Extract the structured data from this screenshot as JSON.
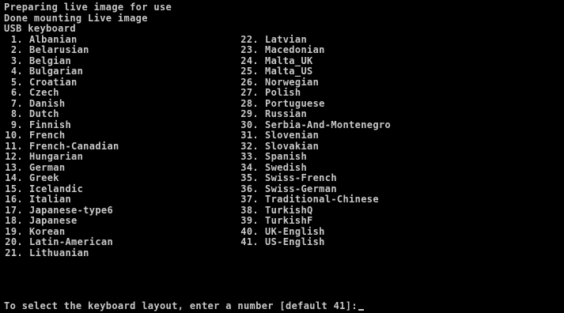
{
  "colors": {
    "background": "#000000",
    "text": "#c8c8c8"
  },
  "console": {
    "status_lines": [
      "Preparing live image for use",
      "Done mounting Live image",
      "USB keyboard"
    ],
    "keyboard_layouts": {
      "left": [
        {
          "num": "1.",
          "label": "Albanian"
        },
        {
          "num": "2.",
          "label": "Belarusian"
        },
        {
          "num": "3.",
          "label": "Belgian"
        },
        {
          "num": "4.",
          "label": "Bulgarian"
        },
        {
          "num": "5.",
          "label": "Croatian"
        },
        {
          "num": "6.",
          "label": "Czech"
        },
        {
          "num": "7.",
          "label": "Danish"
        },
        {
          "num": "8.",
          "label": "Dutch"
        },
        {
          "num": "9.",
          "label": "Finnish"
        },
        {
          "num": "10.",
          "label": "French"
        },
        {
          "num": "11.",
          "label": "French-Canadian"
        },
        {
          "num": "12.",
          "label": "Hungarian"
        },
        {
          "num": "13.",
          "label": "German"
        },
        {
          "num": "14.",
          "label": "Greek"
        },
        {
          "num": "15.",
          "label": "Icelandic"
        },
        {
          "num": "16.",
          "label": "Italian"
        },
        {
          "num": "17.",
          "label": "Japanese-type6"
        },
        {
          "num": "18.",
          "label": "Japanese"
        },
        {
          "num": "19.",
          "label": "Korean"
        },
        {
          "num": "20.",
          "label": "Latin-American"
        },
        {
          "num": "21.",
          "label": "Lithuanian"
        }
      ],
      "right": [
        {
          "num": "22.",
          "label": "Latvian"
        },
        {
          "num": "23.",
          "label": "Macedonian"
        },
        {
          "num": "24.",
          "label": "Malta_UK"
        },
        {
          "num": "25.",
          "label": "Malta_US"
        },
        {
          "num": "26.",
          "label": "Norwegian"
        },
        {
          "num": "27.",
          "label": "Polish"
        },
        {
          "num": "28.",
          "label": "Portuguese"
        },
        {
          "num": "29.",
          "label": "Russian"
        },
        {
          "num": "30.",
          "label": "Serbia-And-Montenegro"
        },
        {
          "num": "31.",
          "label": "Slovenian"
        },
        {
          "num": "32.",
          "label": "Slovakian"
        },
        {
          "num": "33.",
          "label": "Spanish"
        },
        {
          "num": "34.",
          "label": "Swedish"
        },
        {
          "num": "35.",
          "label": "Swiss-French"
        },
        {
          "num": "36.",
          "label": "Swiss-German"
        },
        {
          "num": "37.",
          "label": "Traditional-Chinese"
        },
        {
          "num": "38.",
          "label": "TurkishQ"
        },
        {
          "num": "39.",
          "label": "TurkishF"
        },
        {
          "num": "40.",
          "label": "UK-English"
        },
        {
          "num": "41.",
          "label": "US-English"
        }
      ]
    },
    "prompt": "To select the keyboard layout, enter a number [default 41]:"
  }
}
